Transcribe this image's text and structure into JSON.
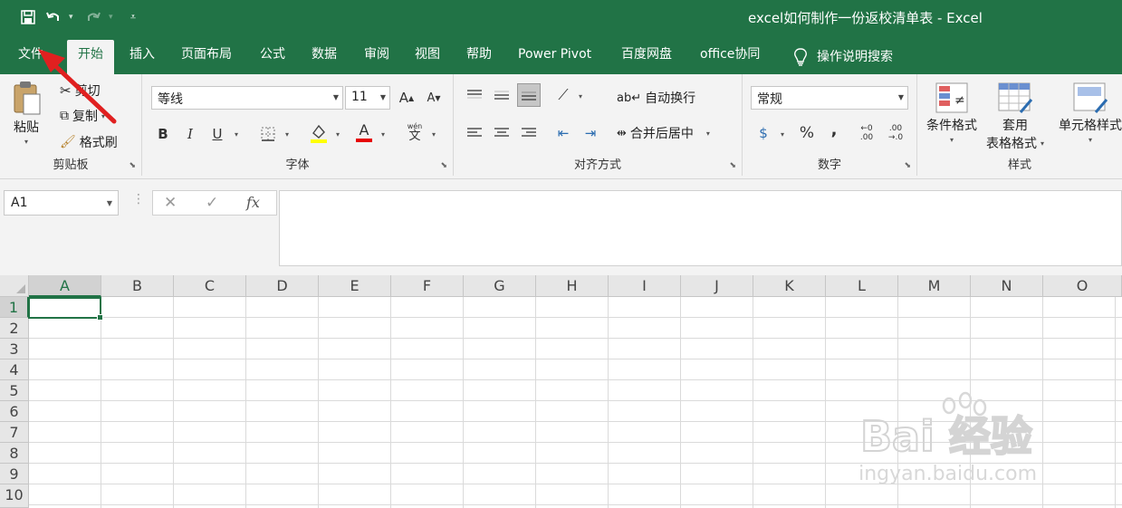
{
  "window": {
    "title": "excel如何制作一份返校清单表  -  Excel"
  },
  "qat": {
    "save": "save-icon",
    "undo": "undo-icon",
    "redo": "redo-icon",
    "customize": "customize-icon"
  },
  "tabs": [
    {
      "label": "文件"
    },
    {
      "label": "开始"
    },
    {
      "label": "插入"
    },
    {
      "label": "页面布局"
    },
    {
      "label": "公式"
    },
    {
      "label": "数据"
    },
    {
      "label": "审阅"
    },
    {
      "label": "视图"
    },
    {
      "label": "帮助"
    },
    {
      "label": "Power Pivot"
    },
    {
      "label": "百度网盘"
    },
    {
      "label": "office协同"
    }
  ],
  "tell_me": {
    "label": "操作说明搜索"
  },
  "clipboard": {
    "group": "剪贴板",
    "paste": "粘贴",
    "cut": "剪切",
    "copy": "复制",
    "format_painter": "格式刷"
  },
  "font": {
    "group": "字体",
    "name": "等线",
    "size": "11",
    "bold": "B",
    "italic": "I",
    "underline": "U",
    "phonetic": "wén",
    "phonetic_char": "文",
    "font_color": "#e60000",
    "fill_color": "#ffff00"
  },
  "alignment": {
    "group": "对齐方式",
    "wrap": "自动换行",
    "merge": "合并后居中"
  },
  "number": {
    "group": "数字",
    "format": "常规",
    "percent": "%",
    "comma": ","
  },
  "styles": {
    "group": "样式",
    "conditional": "条件格式",
    "table_1": "套用",
    "table_2": "表格格式",
    "cell_styles": "单元格样式"
  },
  "formula_bar": {
    "name_box": "A1",
    "fx": "fx",
    "value": ""
  },
  "grid": {
    "columns": [
      "A",
      "B",
      "C",
      "D",
      "E",
      "F",
      "G",
      "H",
      "I",
      "J",
      "K",
      "L",
      "M",
      "N",
      "O"
    ],
    "rows": [
      "1",
      "2",
      "3",
      "4",
      "5",
      "6",
      "7",
      "8",
      "9",
      "10"
    ],
    "active_cell": "A1"
  },
  "watermark": {
    "text": "Bai 经验",
    "url_text": "jingyan.baidu.com"
  },
  "colors": {
    "accent": "#217346",
    "arrow": "#e02020"
  }
}
